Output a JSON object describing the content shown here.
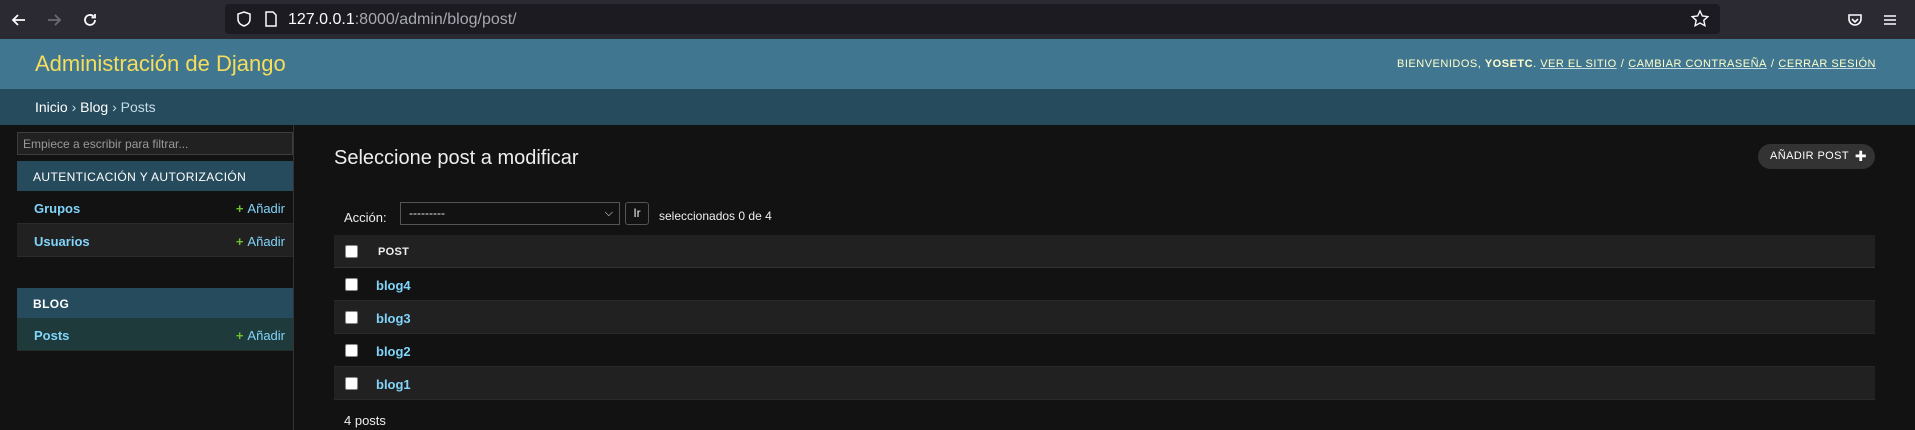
{
  "browser": {
    "url_host": "127.0.0.1",
    "url_rest": ":8000/admin/blog/post/"
  },
  "header": {
    "site_name": "Administración de Django",
    "welcome": "Bienvenidos,",
    "username": "yosetc",
    "view_site": "Ver el sitio",
    "change_password": "Cambiar contraseña",
    "logout": "Cerrar sesión"
  },
  "breadcrumbs": {
    "home": "Inicio",
    "app": "Blog",
    "current": "Posts",
    "separator": "›"
  },
  "sidebar": {
    "filter_placeholder": "Empiece a escribir para filtrar...",
    "apps": [
      {
        "caption": "Autenticación y autorización",
        "models": [
          {
            "name": "Grupos",
            "add": "Añadir"
          },
          {
            "name": "Usuarios",
            "add": "Añadir"
          }
        ]
      },
      {
        "caption": "Blog",
        "models": [
          {
            "name": "Posts",
            "add": "Añadir"
          }
        ]
      }
    ]
  },
  "content": {
    "title": "Seleccione post a modificar",
    "add_button": "Añadir post",
    "action_label": "Acción:",
    "action_selected": "---------",
    "go_button": "Ir",
    "selection_counter": "seleccionados 0 de 4",
    "column_header": "Post",
    "rows": [
      "blog4",
      "blog3",
      "blog2",
      "blog1"
    ],
    "paginator": "4 posts"
  },
  "colors": {
    "header_bg": "#417690",
    "breadcrumbs_bg": "#264b5d",
    "branding": "#f5dd5d",
    "link": "#81d4fa",
    "add_icon": "#70bf2b"
  }
}
